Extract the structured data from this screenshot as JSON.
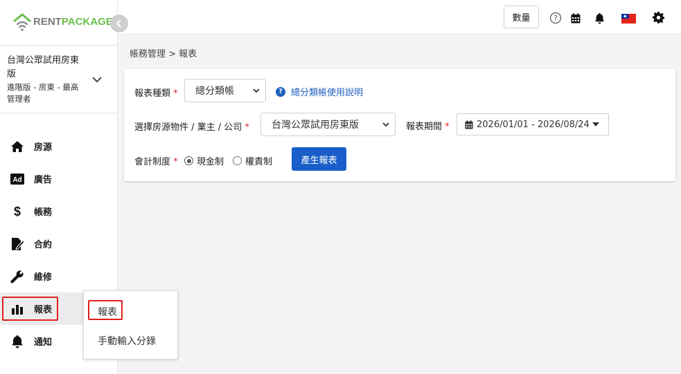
{
  "brand": {
    "name_part1": "RENT",
    "name_part2": "PACKAGE",
    "collapse_icon": "chevron-left-icon"
  },
  "account": {
    "name": "台灣公眾試用房東版",
    "role": "進階版 - 房東 - 最高管理者"
  },
  "menu": [
    {
      "icon": "home-icon",
      "label": "房源"
    },
    {
      "icon": "ad-icon",
      "label": "廣告"
    },
    {
      "icon": "dollar-icon",
      "label": "帳務"
    },
    {
      "icon": "contract-icon",
      "label": "合約"
    },
    {
      "icon": "wrench-icon",
      "label": "維修"
    },
    {
      "icon": "bar-chart-icon",
      "label": "報表",
      "active": true
    },
    {
      "icon": "bell-icon",
      "label": "通知"
    }
  ],
  "submenu": {
    "items": [
      "報表",
      "手動輸入分錄"
    ]
  },
  "topbar": {
    "qty_label": "數量",
    "icons": [
      "help-icon",
      "calendar-icon",
      "bell-icon",
      "taiwan-flag-icon",
      "gear-icon"
    ]
  },
  "breadcrumb": "帳務管理 > 報表",
  "form": {
    "report_type": {
      "label": "報表種類",
      "required_mark": "*",
      "value": "總分類帳"
    },
    "help_link": "總分類帳使用說明",
    "property": {
      "label": "選擇房源物件 / 業主 / 公司",
      "required_mark": "*",
      "value": "台灣公眾試用房東版"
    },
    "period": {
      "label": "報表期間",
      "required_mark": "*",
      "value": "2026/01/01 - 2026/08/24"
    },
    "accounting": {
      "label": "會計制度",
      "required_mark": "*",
      "options": [
        {
          "label": "現金制",
          "selected": true
        },
        {
          "label": "權責制",
          "selected": false
        }
      ]
    },
    "generate_button": "產生報表"
  },
  "colors": {
    "accent_blue": "#1a5fc9",
    "brand_green": "#6abf4b",
    "required_red": "#d9262c",
    "highlight_red": "#e0201b"
  }
}
